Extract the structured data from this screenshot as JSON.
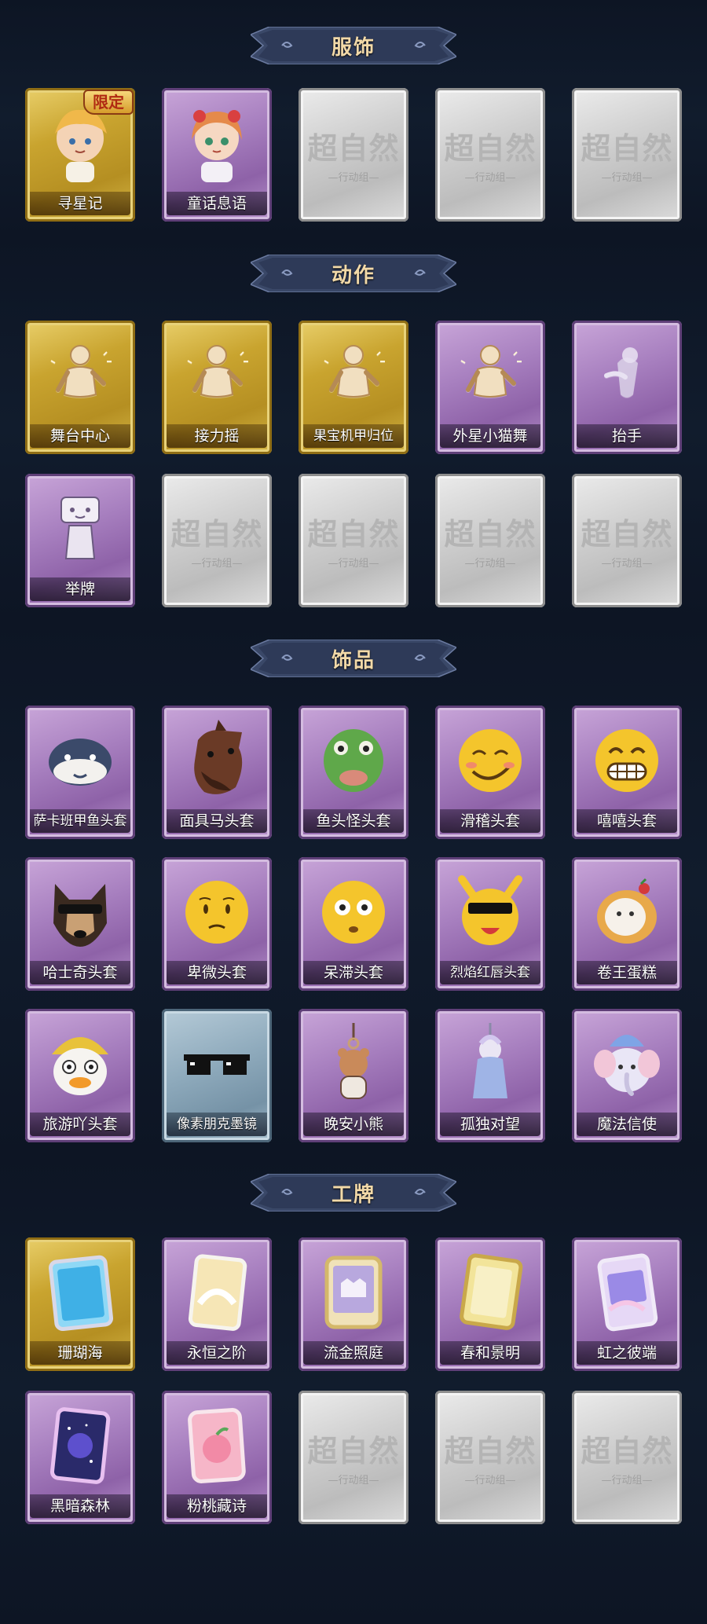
{
  "placeholder": {
    "main": "超自然",
    "sub": "—行动组—"
  },
  "sections": [
    {
      "id": "costume",
      "title": "服饰",
      "cards": [
        {
          "label": "寻星记",
          "rarity": "gold",
          "art": "chibi-boy-icon",
          "badge": "限定"
        },
        {
          "label": "童话息语",
          "rarity": "purple",
          "art": "chibi-girl-icon"
        },
        {
          "rarity": "empty"
        },
        {
          "rarity": "empty"
        },
        {
          "rarity": "empty"
        }
      ]
    },
    {
      "id": "action",
      "title": "动作",
      "cards": [
        {
          "label": "舞台中心",
          "rarity": "gold",
          "art": "pose-icon"
        },
        {
          "label": "接力摇",
          "rarity": "gold",
          "art": "pose-icon"
        },
        {
          "label": "果宝机甲归位",
          "rarity": "gold",
          "art": "pose-icon"
        },
        {
          "label": "外星小猫舞",
          "rarity": "purple",
          "art": "pose-icon"
        },
        {
          "label": "抬手",
          "rarity": "purple",
          "art": "pose-ghost-icon"
        },
        {
          "label": "举牌",
          "rarity": "purple",
          "art": "sign-pose-icon"
        },
        {
          "rarity": "empty"
        },
        {
          "rarity": "empty"
        },
        {
          "rarity": "empty"
        },
        {
          "rarity": "empty"
        }
      ]
    },
    {
      "id": "accessory",
      "title": "饰品",
      "cards": [
        {
          "label": "萨卡班甲鱼头套",
          "rarity": "purple",
          "art": "fish-head-icon"
        },
        {
          "label": "面具马头套",
          "rarity": "purple",
          "art": "horse-head-icon"
        },
        {
          "label": "鱼头怪头套",
          "rarity": "purple",
          "art": "frog-head-icon"
        },
        {
          "label": "滑稽头套",
          "rarity": "purple",
          "art": "funny-face-icon"
        },
        {
          "label": "嘻嘻头套",
          "rarity": "purple",
          "art": "grin-face-icon"
        },
        {
          "label": "哈士奇头套",
          "rarity": "purple",
          "art": "husky-head-icon"
        },
        {
          "label": "卑微头套",
          "rarity": "purple",
          "art": "humble-face-icon"
        },
        {
          "label": "呆滞头套",
          "rarity": "purple",
          "art": "dazed-face-icon"
        },
        {
          "label": "烈焰红唇头套",
          "rarity": "purple",
          "art": "pikachu-head-icon"
        },
        {
          "label": "卷王蛋糕",
          "rarity": "purple",
          "art": "cake-roll-icon"
        },
        {
          "label": "旅游吖头套",
          "rarity": "purple",
          "art": "duck-head-icon"
        },
        {
          "label": "像素朋克墨镜",
          "rarity": "blue",
          "art": "pixel-sunglasses-icon"
        },
        {
          "label": "晚安小熊",
          "rarity": "purple",
          "art": "bear-charm-icon"
        },
        {
          "label": "孤独对望",
          "rarity": "purple",
          "art": "figurine-charm-icon"
        },
        {
          "label": "魔法信使",
          "rarity": "purple",
          "art": "elephant-plush-icon"
        }
      ]
    },
    {
      "id": "badge",
      "title": "工牌",
      "cards": [
        {
          "label": "珊瑚海",
          "rarity": "gold",
          "art": "card-blue-icon"
        },
        {
          "label": "永恒之阶",
          "rarity": "purple",
          "art": "card-angel-icon"
        },
        {
          "label": "流金照庭",
          "rarity": "purple",
          "art": "card-castle-icon"
        },
        {
          "label": "春和景明",
          "rarity": "purple",
          "art": "card-gold-icon"
        },
        {
          "label": "虹之彼端",
          "rarity": "purple",
          "art": "card-rainbow-icon"
        },
        {
          "label": "黑暗森林",
          "rarity": "purple",
          "art": "card-galaxy-icon"
        },
        {
          "label": "粉桃藏诗",
          "rarity": "purple",
          "art": "card-peach-icon"
        },
        {
          "rarity": "empty"
        },
        {
          "rarity": "empty"
        },
        {
          "rarity": "empty"
        }
      ]
    }
  ],
  "colors": {
    "background": "#0e1726",
    "gold": "#c9a42f",
    "purple": "#a77fbf",
    "blue": "#8da9bb",
    "empty": "#cfcfcf",
    "title": "#f2d9a8"
  }
}
